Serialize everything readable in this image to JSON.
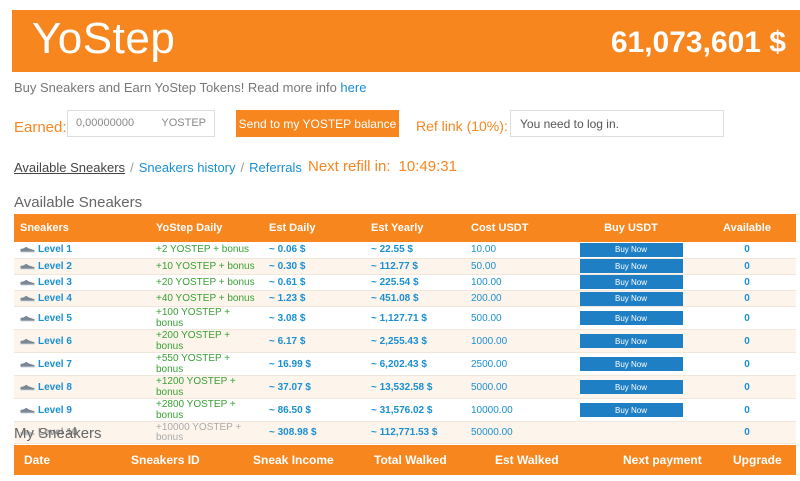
{
  "header": {
    "brand": "YoStep",
    "balance": "61,073,601 $"
  },
  "info": {
    "text": "Buy Sneakers and Earn YoStep Tokens! Read more info ",
    "link": "here"
  },
  "earned": {
    "label": "Earned:",
    "value": "0,00000000",
    "unit": "YOSTEP"
  },
  "send_button": "Send to my YOSTEP balance",
  "ref": {
    "label": "Ref link (10%):",
    "value": "You need to log in."
  },
  "nav": {
    "available": "Available Sneakers",
    "history": "Sneakers history",
    "referrals": "Referrals",
    "sep": "/"
  },
  "refill": {
    "label": "Next refill in:",
    "time": "10:49:31"
  },
  "available_title": "Available Sneakers",
  "available_columns": [
    "Sneakers",
    "YoStep Daily",
    "Est Daily",
    "Est Yearly",
    "Cost USDT",
    "Buy USDT",
    "Available"
  ],
  "levels": [
    {
      "name": "Level 1",
      "daily": "+2 YOSTEP + bonus",
      "est_daily": "~ 0.06 $",
      "est_yearly": "~ 22.55 $",
      "cost": "10.00",
      "buy": "Buy Now",
      "available": "0"
    },
    {
      "name": "Level 2",
      "daily": "+10 YOSTEP + bonus",
      "est_daily": "~ 0.30 $",
      "est_yearly": "~ 112.77 $",
      "cost": "50.00",
      "buy": "Buy Now",
      "available": "0"
    },
    {
      "name": "Level 3",
      "daily": "+20 YOSTEP + bonus",
      "est_daily": "~ 0.61 $",
      "est_yearly": "~ 225.54 $",
      "cost": "100.00",
      "buy": "Buy Now",
      "available": "0"
    },
    {
      "name": "Level 4",
      "daily": "+40 YOSTEP + bonus",
      "est_daily": "~ 1.23 $",
      "est_yearly": "~ 451.08 $",
      "cost": "200.00",
      "buy": "Buy Now",
      "available": "0"
    },
    {
      "name": "Level 5",
      "daily": "+100 YOSTEP + bonus",
      "est_daily": "~ 3.08 $",
      "est_yearly": "~ 1,127.71 $",
      "cost": "500.00",
      "buy": "Buy Now",
      "available": "0"
    },
    {
      "name": "Level 6",
      "daily": "+200 YOSTEP + bonus",
      "est_daily": "~ 6.17 $",
      "est_yearly": "~ 2,255.43 $",
      "cost": "1000.00",
      "buy": "Buy Now",
      "available": "0"
    },
    {
      "name": "Level 7",
      "daily": "+550 YOSTEP + bonus",
      "est_daily": "~ 16.99 $",
      "est_yearly": "~ 6,202.43 $",
      "cost": "2500.00",
      "buy": "Buy Now",
      "available": "0"
    },
    {
      "name": "Level 8",
      "daily": "+1200 YOSTEP + bonus",
      "est_daily": "~ 37.07 $",
      "est_yearly": "~ 13,532.58 $",
      "cost": "5000.00",
      "buy": "Buy Now",
      "available": "0"
    },
    {
      "name": "Level 9",
      "daily": "+2800 YOSTEP + bonus",
      "est_daily": "~ 86.50 $",
      "est_yearly": "~ 31,576.02 $",
      "cost": "10000.00",
      "buy": "Buy Now",
      "available": "0"
    },
    {
      "name": "Level 10",
      "daily": "+10000 YOSTEP + bonus",
      "est_daily": "~ 308.98 $",
      "est_yearly": "~ 112,771.53 $",
      "cost": "50000.00",
      "buy": "",
      "available": "0",
      "disabled": true
    }
  ],
  "my_title": "My Sneakers",
  "my_columns": [
    "Date",
    "Sneakers ID",
    "Sneak Income",
    "Total Walked",
    "Est Walked",
    "Next payment",
    "Upgrade"
  ],
  "colors": {
    "accent": "#f7861f",
    "link": "#1a8fd1",
    "buy_button": "#1f7fc4",
    "green": "#3aa035"
  }
}
